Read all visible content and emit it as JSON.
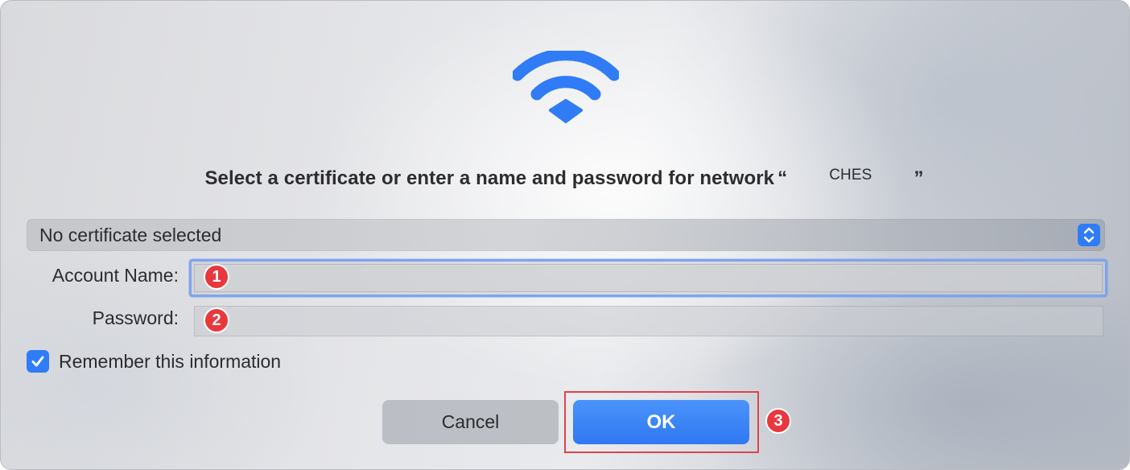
{
  "dialog": {
    "prompt_prefix": "Select a certificate or enter a name and password for network",
    "open_quote": "“",
    "network_name": "CHES",
    "close_quote": "”"
  },
  "certificate": {
    "selected": "No certificate selected"
  },
  "form": {
    "account_label": "Account Name:",
    "account_value": "",
    "password_label": "Password:",
    "password_value": "",
    "remember_label": "Remember this information",
    "remember_checked": true
  },
  "buttons": {
    "cancel": "Cancel",
    "ok": "OK"
  },
  "annotations": {
    "step1": "1",
    "step2": "2",
    "step3": "3"
  },
  "colors": {
    "accent": "#2f7cf6",
    "annotation": "#e8383d"
  },
  "icons": {
    "header": "wifi-icon",
    "popup": "up-down-chevron-icon",
    "checkbox": "checkmark-icon"
  }
}
